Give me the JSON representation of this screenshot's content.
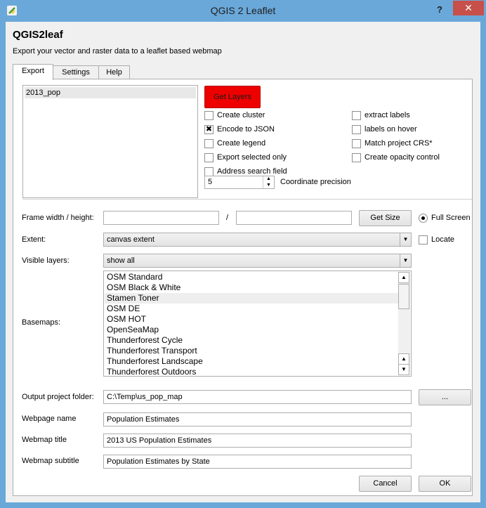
{
  "window": {
    "title": "QGIS 2 Leaflet",
    "help_glyph": "?",
    "close_glyph": "✕",
    "icon": "qgis-logo-icon",
    "accent": "#6aa8d9"
  },
  "header": {
    "title": "QGIS2leaf",
    "subtitle": "Export your vector and raster data to a leaflet based webmap"
  },
  "tabs": [
    {
      "label": "Export",
      "active": true
    },
    {
      "label": "Settings",
      "active": false
    },
    {
      "label": "Help",
      "active": false
    }
  ],
  "layers": {
    "items": [
      "2013_pop"
    ]
  },
  "buttons": {
    "get_layers": "Get Layers",
    "get_size": "Get Size",
    "browse": "...",
    "cancel": "Cancel",
    "ok": "OK"
  },
  "options_left": [
    {
      "label": "Create cluster",
      "checked": false
    },
    {
      "label": "Encode to JSON",
      "checked": true
    },
    {
      "label": "Create legend",
      "checked": false
    },
    {
      "label": "Export selected only",
      "checked": false
    },
    {
      "label": "Address search field",
      "checked": false
    }
  ],
  "options_right": [
    {
      "label": "extract labels",
      "checked": false
    },
    {
      "label": "labels on hover",
      "checked": false
    },
    {
      "label": "Match project CRS*",
      "checked": false
    },
    {
      "label": "Create opacity control",
      "checked": false
    }
  ],
  "precision": {
    "value": "5",
    "label": "Coordinate precision"
  },
  "frame": {
    "label": "Frame width / height:",
    "separator": "/",
    "width_value": "",
    "height_value": "",
    "full_screen_label": "Full Screen",
    "full_screen_selected": true
  },
  "extent": {
    "label": "Extent:",
    "value": "canvas extent",
    "locate_label": "Locate",
    "locate_checked": false
  },
  "visible_layers": {
    "label": "Visible layers:",
    "value": "show all"
  },
  "basemaps": {
    "label": "Basemaps:",
    "items": [
      "OSM Standard",
      "OSM Black & White",
      "Stamen Toner",
      "OSM DE",
      "OSM HOT",
      "OpenSeaMap",
      "Thunderforest Cycle",
      "Thunderforest Transport",
      "Thunderforest Landscape",
      "Thunderforest Outdoors"
    ],
    "highlighted": "Stamen Toner"
  },
  "output_folder": {
    "label": "Output project folder:",
    "value": "C:\\Temp\\us_pop_map"
  },
  "webpage_name": {
    "label": "Webpage name",
    "value": "Population Estimates"
  },
  "webmap_title": {
    "label": "Webmap title",
    "value": "2013 US Population Estimates"
  },
  "webmap_subtitle": {
    "label": "Webmap subtitle",
    "value": "Population Estimates by State"
  },
  "colors": {
    "get_layers_bg": "#ee0000",
    "close_bg": "#c7504a"
  }
}
